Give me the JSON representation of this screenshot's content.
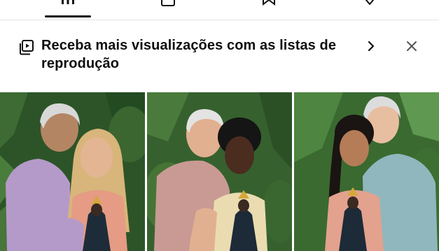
{
  "banner": {
    "icon": "playlist-play-icon",
    "text": "Receba mais visualizações com as listas de reprodução",
    "chevron_icon": "chevron-right-icon",
    "close_icon": "close-icon"
  },
  "tabs": [
    {
      "icon": "grid-icon",
      "selected": true
    },
    {
      "icon": "playlist-icon",
      "selected": false
    },
    {
      "icon": "bookmark-icon",
      "selected": false
    },
    {
      "icon": "heart-icon",
      "selected": false
    }
  ],
  "thumbnails": [
    {
      "id": "thumb-1"
    },
    {
      "id": "thumb-2"
    },
    {
      "id": "thumb-3"
    }
  ],
  "colors": {
    "text": "#0f0f0f",
    "divider": "#e5e5e5",
    "foliage": "#2f5a2c"
  }
}
